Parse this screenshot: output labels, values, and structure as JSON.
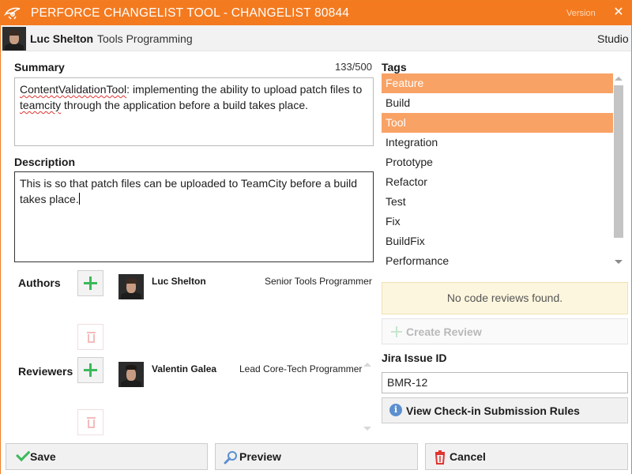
{
  "window": {
    "title": "PERFORCE CHANGELIST TOOL - CHANGELIST 80844",
    "version_label": "Version",
    "close_glyph": "✕"
  },
  "user": {
    "name": "Luc Shelton",
    "team": "Tools Programming",
    "studio": "Studio"
  },
  "summary": {
    "label": "Summary",
    "counter": "133/500",
    "text_part1": "ContentValidationTool",
    "text_part2": ": implementing the ability to upload patch files to ",
    "text_part3": "teamcity",
    "text_part4": " through the application before a build takes place."
  },
  "description": {
    "label": "Description",
    "text": "This is so that patch files can be uploaded to TeamCity before a build takes place."
  },
  "authors": {
    "label": "Authors",
    "people": [
      {
        "name": "Luc Shelton",
        "role": "Senior Tools Programmer"
      }
    ]
  },
  "reviewers": {
    "label": "Reviewers",
    "people": [
      {
        "name": "Valentin Galea",
        "role": "Lead Core-Tech Programmer"
      }
    ]
  },
  "tags": {
    "label": "Tags",
    "items": [
      {
        "label": "Feature",
        "selected": true
      },
      {
        "label": "Build",
        "selected": false
      },
      {
        "label": "Tool",
        "selected": true
      },
      {
        "label": "Integration",
        "selected": false
      },
      {
        "label": "Prototype",
        "selected": false
      },
      {
        "label": "Refactor",
        "selected": false
      },
      {
        "label": "Test",
        "selected": false
      },
      {
        "label": "Fix",
        "selected": false
      },
      {
        "label": "BuildFix",
        "selected": false
      },
      {
        "label": "Performance",
        "selected": false
      }
    ]
  },
  "reviews": {
    "empty_message": "No code reviews found.",
    "create_label": "Create Review"
  },
  "jira": {
    "label": "Jira Issue ID",
    "value": "BMR-12"
  },
  "rules_button": "View Check-in Submission Rules",
  "actions": {
    "save": "Save",
    "preview": "Preview",
    "cancel": "Cancel"
  },
  "colors": {
    "accent": "#f47a1f",
    "tag_selected": "#f8a265",
    "success": "#3cb95b",
    "danger": "#e0342f",
    "info": "#5c8fd0"
  }
}
